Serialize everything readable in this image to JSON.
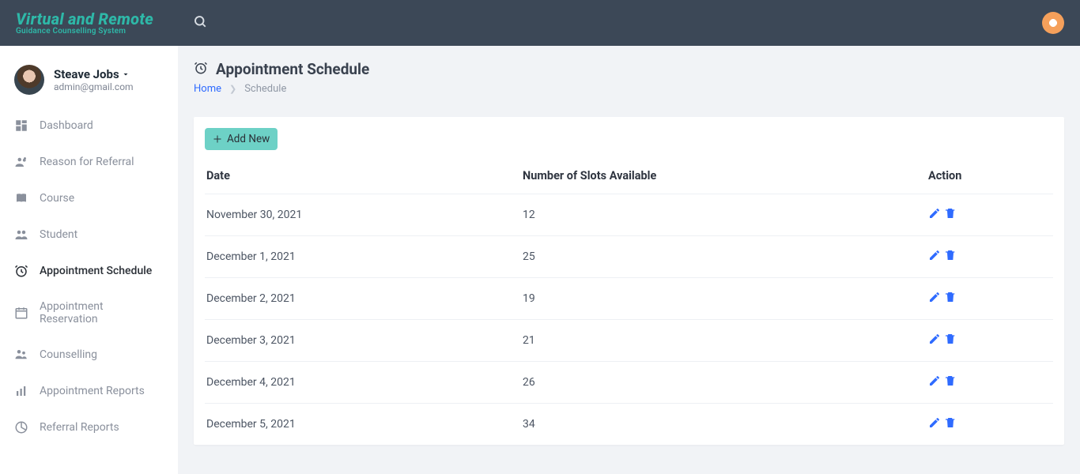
{
  "brand": {
    "title": "Virtual and Remote",
    "subtitle": "Guidance Counselling System"
  },
  "user": {
    "name": "Steave Jobs",
    "email": "admin@gmail.com"
  },
  "sidebar": {
    "items": [
      {
        "label": "Dashboard"
      },
      {
        "label": "Reason for Referral"
      },
      {
        "label": "Course"
      },
      {
        "label": "Student"
      },
      {
        "label": "Appointment Schedule"
      },
      {
        "label": "Appointment Reservation"
      },
      {
        "label": "Counselling"
      },
      {
        "label": "Appointment Reports"
      },
      {
        "label": "Referral Reports"
      }
    ]
  },
  "page": {
    "title": "Appointment Schedule",
    "breadcrumb_home": "Home",
    "breadcrumb_current": "Schedule"
  },
  "toolbar": {
    "add_label": "Add New"
  },
  "table": {
    "headers": {
      "date": "Date",
      "slots": "Number of Slots Available",
      "action": "Action"
    },
    "rows": [
      {
        "date": "November 30, 2021",
        "slots": "12"
      },
      {
        "date": "December 1, 2021",
        "slots": "25"
      },
      {
        "date": "December 2, 2021",
        "slots": "19"
      },
      {
        "date": "December 3, 2021",
        "slots": "21"
      },
      {
        "date": "December 4, 2021",
        "slots": "26"
      },
      {
        "date": "December 5, 2021",
        "slots": "34"
      }
    ]
  },
  "colors": {
    "accent_link": "#2f6bff",
    "teal": "#6dd1c6"
  }
}
